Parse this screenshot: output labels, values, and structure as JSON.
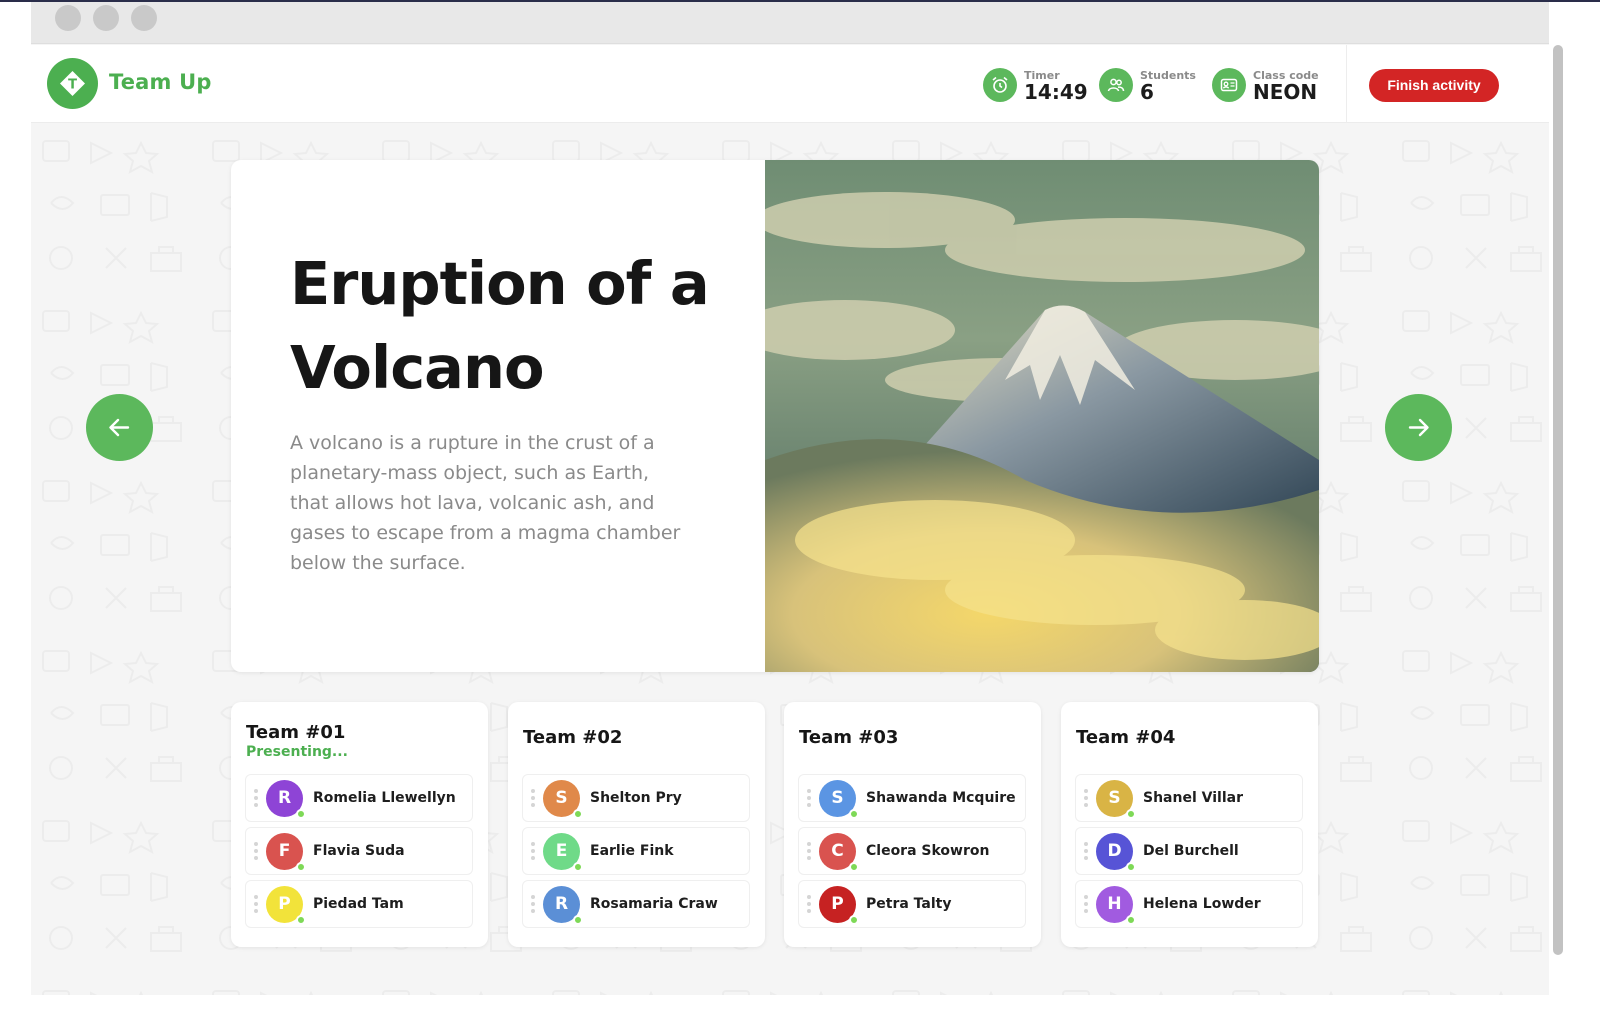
{
  "app": {
    "name": "Team Up",
    "logo_letter": "T"
  },
  "stats": {
    "timer": {
      "label": "Timer",
      "value": "14:49",
      "icon": "alarm-clock-icon"
    },
    "students": {
      "label": "Students",
      "value": "6",
      "icon": "people-icon"
    },
    "class_code": {
      "label": "Class code",
      "value": "NEON",
      "icon": "id-card-icon"
    }
  },
  "actions": {
    "finish": "Finish activity"
  },
  "slide": {
    "title": "Eruption of a Volcano",
    "text": "A volcano is a rupture in the crust of a planetary-mass object, such as Earth, that allows hot lava, volcanic ash, and gases to escape from a magma chamber below the surface."
  },
  "navigation": {
    "prev_icon": "arrow-left-icon",
    "next_icon": "arrow-right-icon"
  },
  "teams": [
    {
      "name": "Team #01",
      "status": "Presenting...",
      "members": [
        {
          "initial": "R",
          "name": "Romelia Llewellyn",
          "color": "#8e44d6"
        },
        {
          "initial": "F",
          "name": "Flavia Suda",
          "color": "#d9534f"
        },
        {
          "initial": "P",
          "name": "Piedad Tam",
          "color": "#f2e33a"
        }
      ]
    },
    {
      "name": "Team #02",
      "status": "",
      "members": [
        {
          "initial": "S",
          "name": "Shelton Pry",
          "color": "#e0894a"
        },
        {
          "initial": "E",
          "name": "Earlie Fink",
          "color": "#6fda88"
        },
        {
          "initial": "R",
          "name": "Rosamaria Craw",
          "color": "#5b8fd6"
        }
      ]
    },
    {
      "name": "Team #03",
      "status": "",
      "members": [
        {
          "initial": "S",
          "name": "Shawanda Mcquire",
          "color": "#5b95e3"
        },
        {
          "initial": "C",
          "name": "Cleora Skowron",
          "color": "#d9534f"
        },
        {
          "initial": "P",
          "name": "Petra Talty",
          "color": "#c62222"
        }
      ]
    },
    {
      "name": "Team #04",
      "status": "",
      "members": [
        {
          "initial": "S",
          "name": "Shanel Villar",
          "color": "#d9b445"
        },
        {
          "initial": "D",
          "name": "Del Burchell",
          "color": "#5754d6"
        },
        {
          "initial": "H",
          "name": "Helena Lowder",
          "color": "#a15be0"
        }
      ]
    }
  ],
  "colors": {
    "accent": "#4caf50",
    "danger": "#d32525",
    "online": "#7ed957"
  }
}
